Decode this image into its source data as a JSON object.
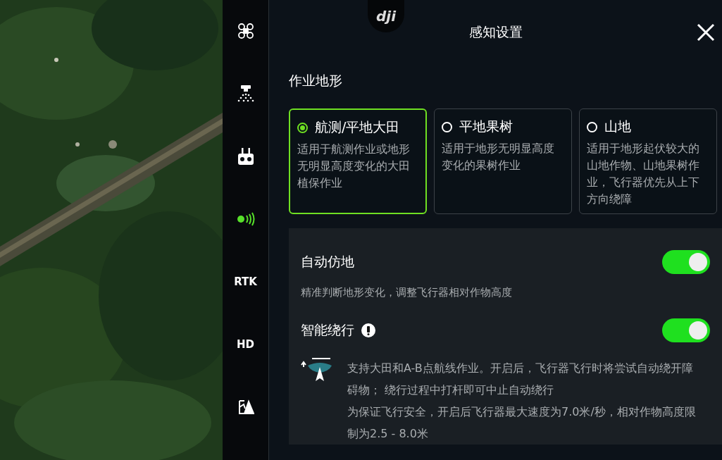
{
  "rail": [
    {
      "kind": "drone",
      "selected": false
    },
    {
      "kind": "sprayer",
      "selected": false
    },
    {
      "kind": "remote",
      "selected": false
    },
    {
      "kind": "signal",
      "selected": true
    },
    {
      "kind": "text",
      "label": "RTK",
      "selected": false
    },
    {
      "kind": "text",
      "label": "HD",
      "selected": false
    },
    {
      "kind": "terrain",
      "selected": false
    }
  ],
  "header": {
    "logo": "dji",
    "title": "感知设置"
  },
  "terrain": {
    "title": "作业地形",
    "options": [
      {
        "label": "航测/平地大田",
        "description": "适用于航测作业或地形无明显高度变化的大田植保作业",
        "selected": true
      },
      {
        "label": "平地果树",
        "description": "适用于地形无明显高度变化的果树作业",
        "selected": false
      },
      {
        "label": "山地",
        "description": "适用于地形起伏较大的山地作物、山地果树作业，飞行器优先从上下方向绕障",
        "selected": false
      }
    ]
  },
  "settings": [
    {
      "label": "自动仿地",
      "on": true,
      "warning": false,
      "description": "精准判断地形变化，调整飞行器相对作物高度"
    },
    {
      "label": "智能绕行",
      "on": true,
      "warning": true,
      "notes": [
        "支持大田和A-B点航线作业。开启后，飞行器飞行时将尝试自动绕开障碍物； 绕行过程中打杆即可中止自动绕行",
        "为保证飞行安全，开启后飞行器最大速度为7.0米/秒，相对作物高度限制为2.5 - 8.0米"
      ]
    }
  ]
}
